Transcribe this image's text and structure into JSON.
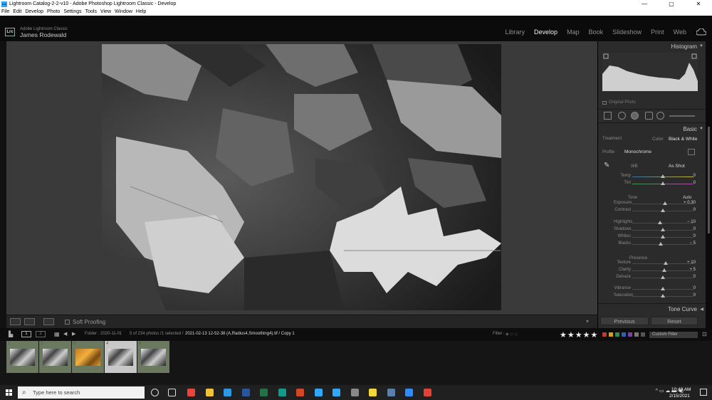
{
  "window": {
    "title": "Lightroom Catalog-2-2-v10 - Adobe Photoshop Lightroom Classic - Develop",
    "app_icon_text": "Lrc",
    "controls": [
      "—",
      "▢",
      "✕"
    ]
  },
  "menu": [
    "File",
    "Edit",
    "Develop",
    "Photo",
    "Settings",
    "Tools",
    "View",
    "Window",
    "Help"
  ],
  "identity": {
    "badge": "Lrc",
    "product": "Adobe Lightroom Classic",
    "user": "James Rodewald"
  },
  "modules": [
    {
      "label": "Library",
      "active": false
    },
    {
      "label": "Develop",
      "active": true
    },
    {
      "label": "Map",
      "active": false
    },
    {
      "label": "Book",
      "active": false
    },
    {
      "label": "Slideshow",
      "active": false
    },
    {
      "label": "Print",
      "active": false
    },
    {
      "label": "Web",
      "active": false
    }
  ],
  "toolbar": {
    "soft_proofing": "Soft Proofing"
  },
  "right_panel": {
    "histogram_title": "Histogram",
    "original_photo": "Original Photo",
    "basic_title": "Basic",
    "treatment_label": "Treatment",
    "treatment_color": "Color",
    "treatment_bw": "Black & White",
    "profile_label": "Profile",
    "profile_value": "Monochrome",
    "wb_label": "WB",
    "wb_value": "As Shot",
    "tone_label": "Tone",
    "auto_label": "Auto",
    "presence_label": "Presence",
    "tone_curve_title": "Tone Curve",
    "previous_button": "Previous",
    "reset_button": "Reset",
    "sliders": [
      {
        "name": "Temp",
        "value": "0",
        "pos": 0.5
      },
      {
        "name": "Tint",
        "value": "0",
        "pos": 0.5
      },
      {
        "name": "Exposure",
        "value": "+ 0.30",
        "pos": 0.53
      },
      {
        "name": "Contrast",
        "value": "0",
        "pos": 0.5
      },
      {
        "name": "Highlights",
        "value": "− 10",
        "pos": 0.45
      },
      {
        "name": "Shadows",
        "value": "0",
        "pos": 0.5
      },
      {
        "name": "Whites",
        "value": "0",
        "pos": 0.5
      },
      {
        "name": "Blacks",
        "value": "− 5",
        "pos": 0.47
      },
      {
        "name": "Texture",
        "value": "+ 10",
        "pos": 0.55
      },
      {
        "name": "Clarity",
        "value": "+ 5",
        "pos": 0.52
      },
      {
        "name": "Dehaze",
        "value": "0",
        "pos": 0.5
      },
      {
        "name": "Vibrance",
        "value": "0",
        "pos": 0.5
      },
      {
        "name": "Saturation",
        "value": "0",
        "pos": 0.5
      }
    ]
  },
  "filmbar": {
    "page1": "1",
    "page2": "2",
    "folder": "Folder : 2020-11-01",
    "count": "5 of 234 photos /1 selected /",
    "filename": "2021-02-13 12-52-38 (A,Radius4,Smoothing4).tif / Copy 1",
    "filter_label": "Filter :",
    "stars": "★★★★★",
    "custom_filter": "Custom Filter",
    "color_labels": [
      "#c0392b",
      "#d4a017",
      "#2e8b57",
      "#2f5fb3",
      "#7b3fa0",
      "#777777",
      "#555555"
    ]
  },
  "filmstrip": [
    {
      "num": "1",
      "selected": false,
      "tone": "bw"
    },
    {
      "num": "2",
      "selected": false,
      "tone": "bw"
    },
    {
      "num": "3",
      "selected": false,
      "tone": "color"
    },
    {
      "num": "4",
      "selected": true,
      "tone": "bw"
    },
    {
      "num": "5",
      "selected": false,
      "tone": "bw"
    }
  ],
  "taskbar": {
    "search_placeholder": "Type here to search",
    "time": "10:49 AM",
    "date": "2/15/2021",
    "apps": [
      {
        "name": "chrome-icon",
        "color": "#e8453c"
      },
      {
        "name": "file-explorer-icon",
        "color": "#f2c230"
      },
      {
        "name": "edge-icon",
        "color": "#2b9ae3"
      },
      {
        "name": "word-icon",
        "color": "#2b579a"
      },
      {
        "name": "excel-icon",
        "color": "#217346"
      },
      {
        "name": "publisher-icon",
        "color": "#0f9c8a"
      },
      {
        "name": "powerpoint-icon",
        "color": "#d24726"
      },
      {
        "name": "lightroom-icon",
        "color": "#31a8ff"
      },
      {
        "name": "photoshop-icon",
        "color": "#31a8ff"
      },
      {
        "name": "app-icon",
        "color": "#888888"
      },
      {
        "name": "sticky-notes-icon",
        "color": "#f5d63b"
      },
      {
        "name": "calculator-icon",
        "color": "#5b7fa6"
      },
      {
        "name": "zoom-icon",
        "color": "#2d8cff"
      },
      {
        "name": "acrobat-icon",
        "color": "#e34234"
      }
    ]
  }
}
